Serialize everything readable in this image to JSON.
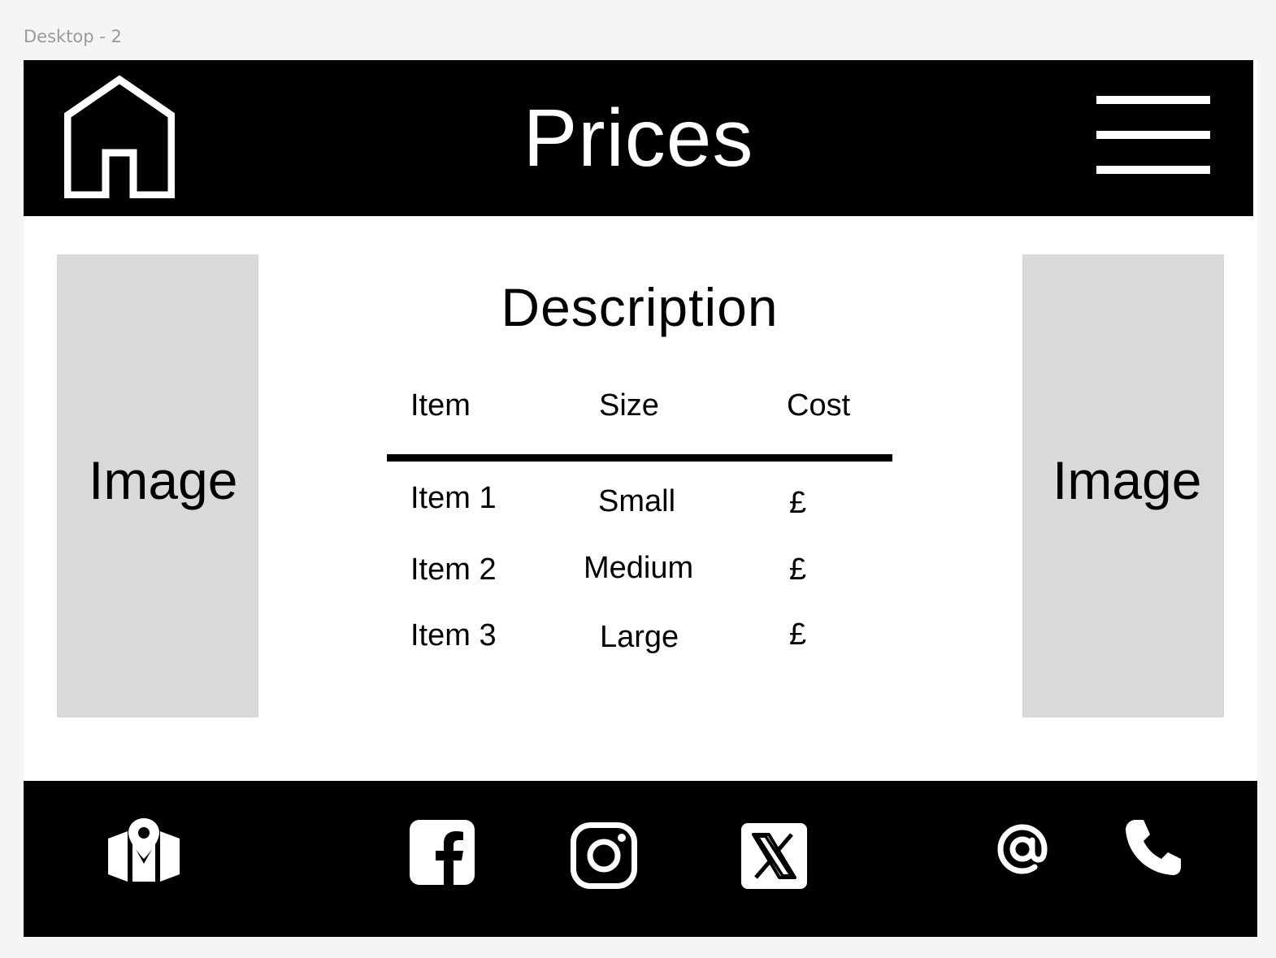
{
  "canvas": {
    "frame_label": "Desktop - 2"
  },
  "header": {
    "title": "Prices",
    "home_icon": "home-icon",
    "menu_icon": "hamburger-menu-icon"
  },
  "main": {
    "left_image_label": "Image",
    "right_image_label": "Image",
    "description_title": "Description",
    "table": {
      "columns": [
        "Item",
        "Size",
        "Cost"
      ],
      "rows": [
        [
          "Item 1",
          "Small",
          "£"
        ],
        [
          "Item 2",
          "Medium",
          "£"
        ],
        [
          "Item 3",
          "Large",
          "£"
        ]
      ]
    }
  },
  "footer": {
    "icons": [
      "map-pin-icon",
      "facebook-icon",
      "instagram-icon",
      "x-twitter-icon",
      "at-sign-icon",
      "phone-icon"
    ]
  },
  "colors": {
    "bar_background": "#000000",
    "page_background": "#ffffff",
    "placeholder": "#d9d9d9",
    "canvas_background": "#f5f5f5",
    "frame_label": "#9a9a9a"
  }
}
